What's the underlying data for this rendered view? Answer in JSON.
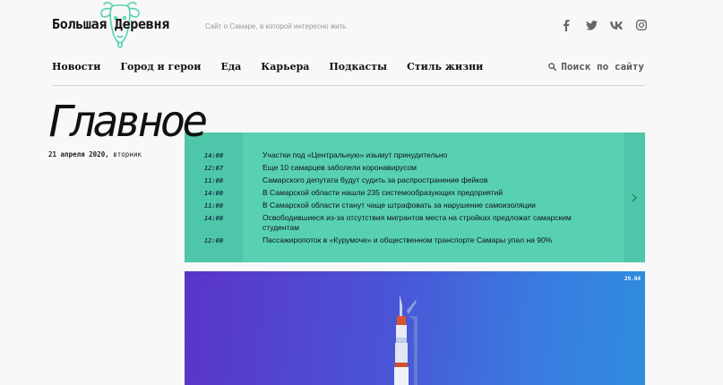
{
  "site": {
    "name": "Большая Деревня",
    "tagline": "Сайт о Самаре, в которой интересно жить",
    "logo_color": "#58d1b3"
  },
  "socials": [
    {
      "icon": "facebook-icon"
    },
    {
      "icon": "twitter-icon"
    },
    {
      "icon": "vk-icon"
    },
    {
      "icon": "instagram-icon"
    }
  ],
  "nav": {
    "items": [
      "Новости",
      "Город и герои",
      "Еда",
      "Карьера",
      "Подкасты",
      "Стиль жизни"
    ],
    "search_label": "Поиск по сайту"
  },
  "main": {
    "title": "Главное",
    "date": "21 апреля 2020,",
    "weekday": "вторник"
  },
  "news": [
    {
      "time": "14:00",
      "headline": "Участки под «Центральную» изымут принудительно"
    },
    {
      "time": "12:07",
      "headline": "Еще 10 самарцев заболели коронавирусом"
    },
    {
      "time": "11:00",
      "headline": "Самарского депутата будут судить за распространение фейков"
    },
    {
      "time": "14:00",
      "headline": "В Самарской области нашли 235 системообразующих предприятий"
    },
    {
      "time": "11:00",
      "headline": "В Самарской области станут чаще штрафовать за нарушение самоизоляции"
    },
    {
      "time": "14:00",
      "headline": "Освободившиеся из-за отсутствия мигрантов места на стройках предложат самарским студентам"
    },
    {
      "time": "12:00",
      "headline": "Пассажиропоток в «Курумоче» и общественном транспорте Самары упал на 90%"
    }
  ],
  "hero": {
    "date": "29.04"
  }
}
